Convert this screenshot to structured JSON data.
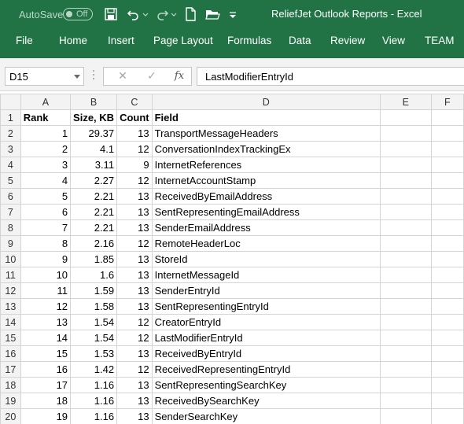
{
  "titlebar": {
    "autosave_label": "AutoSave",
    "autosave_state": "Off",
    "title": "ReliefJet Outlook Reports  -  Excel",
    "icons": [
      "save-icon",
      "undo-icon",
      "redo-icon",
      "new-file-icon",
      "open-folder-icon",
      "customize-toolbar-icon"
    ]
  },
  "ribbon": {
    "tabs": [
      "File",
      "Home",
      "Insert",
      "Page Layout",
      "Formulas",
      "Data",
      "Review",
      "View",
      "TEAM"
    ]
  },
  "formula_bar": {
    "name_box": "D15",
    "cancel_symbol": "✕",
    "enter_symbol": "✓",
    "fx_symbol": "fx",
    "formula": "LastModifierEntryId"
  },
  "sheet": {
    "columns": [
      "A",
      "B",
      "C",
      "D",
      "E",
      "F"
    ],
    "row_numbers": [
      "1",
      "2",
      "3",
      "4",
      "5",
      "6",
      "7",
      "8",
      "9",
      "10",
      "11",
      "12",
      "13",
      "14",
      "15",
      "16",
      "17",
      "18",
      "19",
      "20"
    ],
    "header": [
      "Rank",
      "Size, KB",
      "Count",
      "Field"
    ],
    "rows": [
      [
        "1",
        "29.37",
        "13",
        "TransportMessageHeaders"
      ],
      [
        "2",
        "4.1",
        "12",
        "ConversationIndexTrackingEx"
      ],
      [
        "3",
        "3.11",
        "9",
        "InternetReferences"
      ],
      [
        "4",
        "2.27",
        "12",
        "InternetAccountStamp"
      ],
      [
        "5",
        "2.21",
        "13",
        "ReceivedByEmailAddress"
      ],
      [
        "6",
        "2.21",
        "13",
        "SentRepresentingEmailAddress"
      ],
      [
        "7",
        "2.21",
        "13",
        "SenderEmailAddress"
      ],
      [
        "8",
        "2.16",
        "12",
        "RemoteHeaderLoc"
      ],
      [
        "9",
        "1.85",
        "13",
        "StoreId"
      ],
      [
        "10",
        "1.6",
        "13",
        "InternetMessageId"
      ],
      [
        "11",
        "1.59",
        "13",
        "SenderEntryId"
      ],
      [
        "12",
        "1.58",
        "13",
        "SentRepresentingEntryId"
      ],
      [
        "13",
        "1.54",
        "12",
        "CreatorEntryId"
      ],
      [
        "14",
        "1.54",
        "12",
        "LastModifierEntryId"
      ],
      [
        "15",
        "1.53",
        "13",
        "ReceivedByEntryId"
      ],
      [
        "16",
        "1.42",
        "12",
        "ReceivedRepresentingEntryId"
      ],
      [
        "17",
        "1.16",
        "13",
        "SentRepresentingSearchKey"
      ],
      [
        "18",
        "1.16",
        "13",
        "ReceivedBySearchKey"
      ],
      [
        "19",
        "1.16",
        "13",
        "SenderSearchKey"
      ]
    ]
  },
  "colors": {
    "excel_green": "#217346",
    "header_gray": "#f3f3f3",
    "grid_line": "#d4d4d4"
  }
}
